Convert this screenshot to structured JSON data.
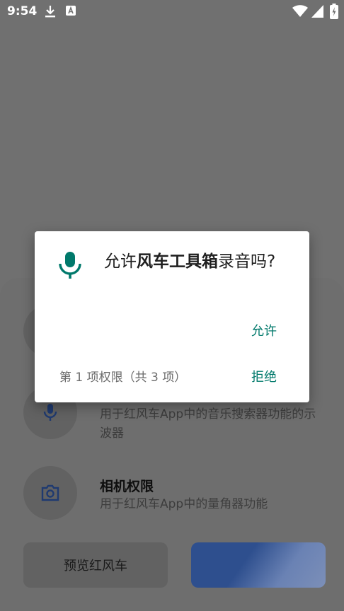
{
  "status_bar": {
    "time": "9:54",
    "icons": [
      "download-icon",
      "a-box-icon",
      "wifi-icon",
      "signal-icon",
      "battery-charging-icon"
    ]
  },
  "sheet": {
    "permissions": [
      {
        "icon": "mic-icon",
        "title": "",
        "description": "用于红风车App中的音乐搜索器功能的示波器"
      },
      {
        "icon": "camera-icon",
        "title": "相机权限",
        "description": "用于红风车App中的量角器功能"
      }
    ],
    "preview_button": "预览红风车"
  },
  "dialog": {
    "title_prefix": "允许",
    "app_name": "风车工具箱",
    "title_suffix": "录音吗?",
    "allow_label": "允许",
    "counter": "第 1 项权限（共 3 项）",
    "deny_label": "拒绝",
    "accent_color": "#00796b"
  }
}
